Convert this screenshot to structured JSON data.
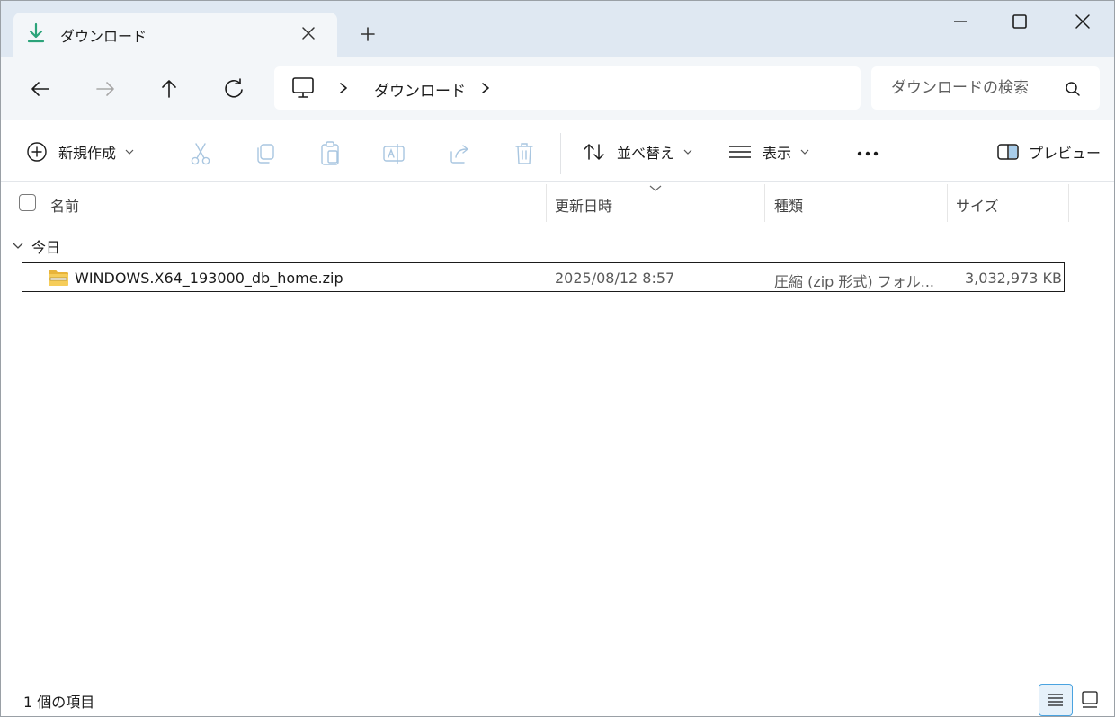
{
  "tab": {
    "title": "ダウンロード",
    "close_icon": "close-icon",
    "icon": "download-icon"
  },
  "newtab": {
    "icon": "plus-icon"
  },
  "window_controls": {
    "minimize": "minimize-icon",
    "maximize": "maximize-icon",
    "close": "close-icon"
  },
  "nav": {
    "back": "arrow-left-icon",
    "forward": "arrow-right-icon",
    "up": "arrow-up-icon",
    "refresh": "refresh-icon"
  },
  "address": {
    "root_icon": "pc-icon",
    "crumbs": [
      "ダウンロード"
    ]
  },
  "search": {
    "placeholder": "ダウンロードの検索"
  },
  "toolbar": {
    "new_label": "新規作成",
    "sort_label": "並べ替え",
    "view_label": "表示",
    "preview_label": "プレビュー",
    "icons": [
      "cut-icon",
      "copy-icon",
      "paste-icon",
      "rename-icon",
      "share-icon",
      "delete-icon",
      "more-icon"
    ]
  },
  "columns": {
    "name": "名前",
    "modified": "更新日時",
    "type": "種類",
    "size": "サイズ"
  },
  "group": {
    "label": "今日"
  },
  "files": [
    {
      "name": "WINDOWS.X64_193000_db_home.zip",
      "modified": "2025/08/12 8:57",
      "type": "圧縮 (zip 形式) フォル...",
      "size": "3,032,973 KB",
      "icon": "zip-folder-icon"
    }
  ],
  "status": {
    "count": "1 個の項目"
  },
  "colors": {
    "titlebar": "#dfe8f2",
    "navrow": "#f3f6f9",
    "accent": "#2ba37a",
    "selected_view": "#4aa3e0"
  }
}
